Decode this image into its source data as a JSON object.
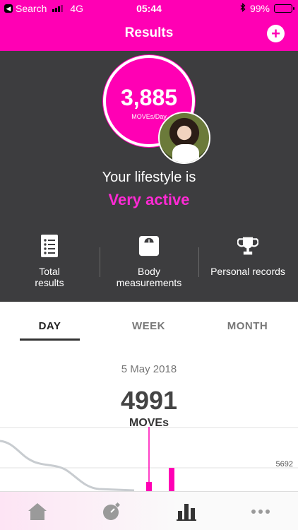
{
  "status_bar": {
    "back_label": "Search",
    "network": "4G",
    "time": "05:44",
    "battery": "99%",
    "battery_level": 0.99
  },
  "header": {
    "title": "Results",
    "add_icon": "plus-circle-icon"
  },
  "summary": {
    "moves_value": "3,885",
    "moves_unit": "MOVEs/Day",
    "lifestyle_label": "Your lifestyle is",
    "lifestyle_level": "Very active",
    "shortcuts": [
      {
        "label_line1": "Total",
        "label_line2": "results",
        "icon": "list-icon"
      },
      {
        "label_line1": "Body",
        "label_line2": "measurements",
        "icon": "scale-icon"
      },
      {
        "label_line1": "Personal records",
        "label_line2": "",
        "icon": "trophy-icon"
      }
    ]
  },
  "tabs": [
    {
      "label": "DAY",
      "active": true
    },
    {
      "label": "WEEK",
      "active": false
    },
    {
      "label": "MONTH",
      "active": false
    }
  ],
  "day_view": {
    "date": "5 May 2018",
    "total": "4991",
    "unit": "MOVEs",
    "reference_value": "5692"
  },
  "colors": {
    "accent": "#ff00b4",
    "dark_panel": "#3d3d3f"
  },
  "tabbar": [
    {
      "icon": "home-icon",
      "active": false
    },
    {
      "icon": "stopwatch-icon",
      "active": false
    },
    {
      "icon": "bar-chart-icon",
      "active": true
    },
    {
      "icon": "more-icon",
      "active": false
    }
  ]
}
